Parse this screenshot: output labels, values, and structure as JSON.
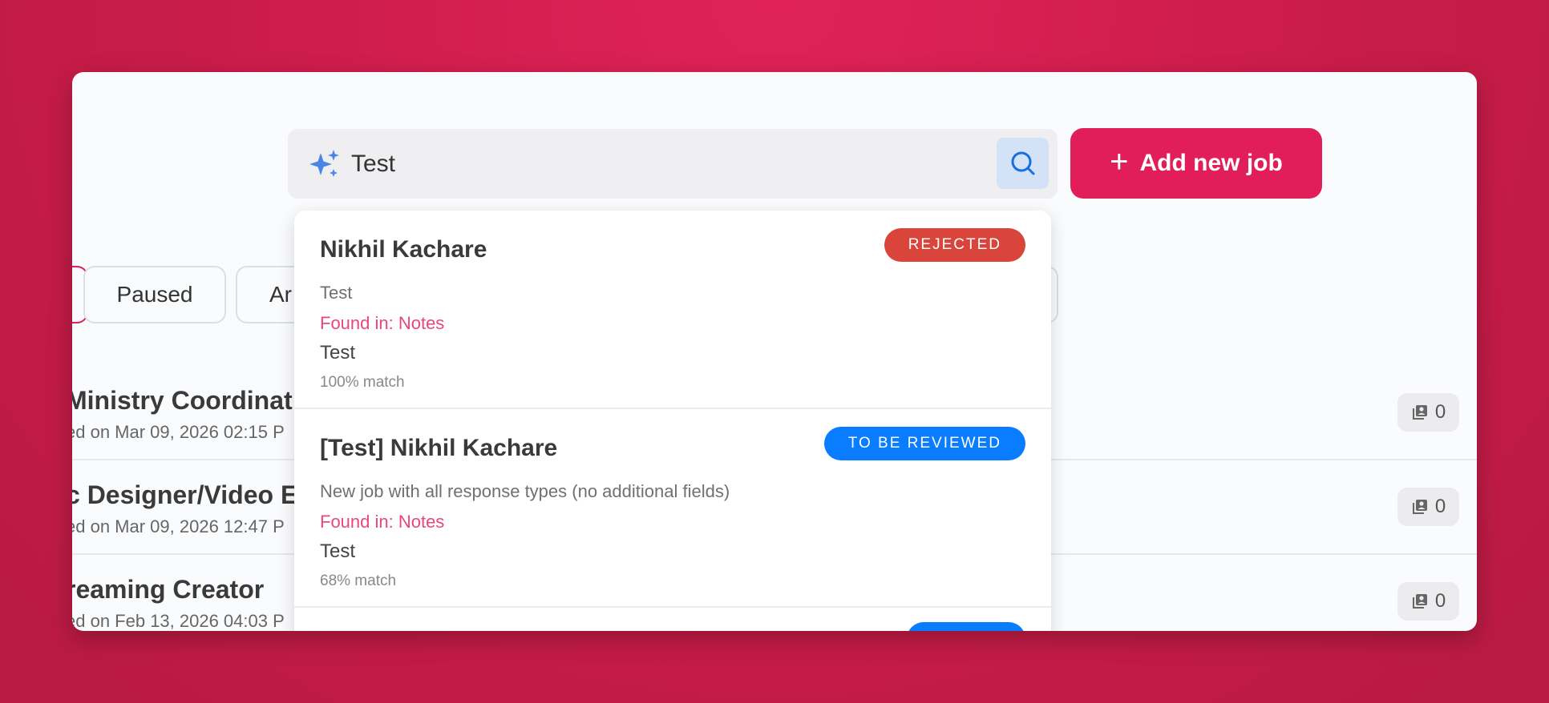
{
  "search": {
    "value": "Test"
  },
  "toolbar": {
    "add_job_label": "Add new job"
  },
  "filters": [
    {
      "label": ""
    },
    {
      "label": "Paused"
    },
    {
      "label": "Ar"
    },
    {
      "label": ""
    }
  ],
  "jobs": [
    {
      "title": "Ministry Coordinat",
      "posted": "ed on Mar 09, 2026 02:15 P",
      "count": "0"
    },
    {
      "title": "c Designer/Video E",
      "posted": "ed on Mar 09, 2026 12:47 P",
      "count": "0"
    },
    {
      "title": "reaming Creator",
      "posted": "ed on Feb 13, 2026 04:03 P",
      "count": "0"
    }
  ],
  "results": [
    {
      "name": "Nikhil Kachare",
      "status": "REJECTED",
      "status_color": "#d9453a",
      "job": "Test",
      "found_in": "Found in: Notes",
      "snippet": "Test",
      "match": "100% match"
    },
    {
      "name": "[Test] Nikhil Kachare",
      "status": "TO BE REVIEWED",
      "status_color": "#0a7cff",
      "job": "New job with all response types (no additional fields)",
      "found_in": "Found in: Notes",
      "snippet": "Test",
      "match": "68% match"
    }
  ],
  "colors": {
    "brand": "#e11d5a",
    "accent_blue": "#0a7cff",
    "found_in": "#e9477a"
  },
  "icons": {
    "sparkle": "sparkle-icon",
    "search": "search-icon",
    "plus": "plus-icon",
    "candidates": "candidates-icon"
  }
}
